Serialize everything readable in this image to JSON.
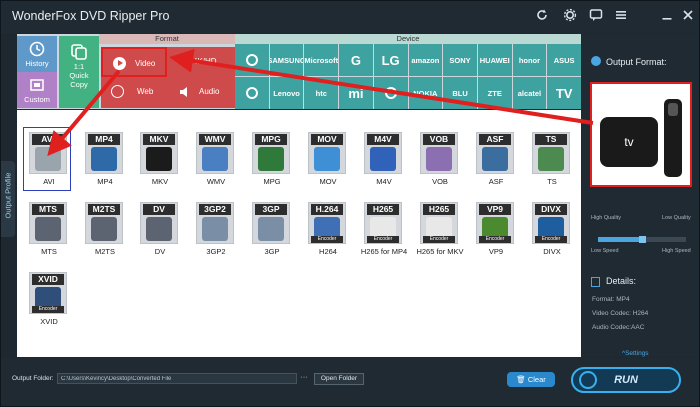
{
  "app": {
    "title": "WonderFox DVD Ripper Pro"
  },
  "ribbon": {
    "format_header": "Format",
    "device_header": "Device",
    "history": "History",
    "custom": "Custom",
    "quick_copy_line1": "1:1",
    "quick_copy_line2": "Quick",
    "quick_copy_line3": "Copy",
    "video": "Video",
    "fourk": "4K/HD",
    "web": "Web",
    "audio": "Audio",
    "brands_row1": [
      "",
      "SAMSUNG",
      "Microsoft",
      "G",
      "LG",
      "amazon",
      "SONY",
      "HUAWEI",
      "honor",
      "ASUS"
    ],
    "brands_row2": [
      "",
      "Lenovo",
      "htc",
      "mi",
      "",
      "NOKIA",
      "BLU",
      "ZTE",
      "alcatel",
      "TV"
    ]
  },
  "profile_tab": "Output Profile",
  "formats": [
    {
      "badge": "AVI",
      "name": "AVI",
      "color": "#9aa4ad"
    },
    {
      "badge": "MP4",
      "name": "MP4",
      "color": "#2e6aa8"
    },
    {
      "badge": "MKV",
      "name": "MKV",
      "color": "#1b1b1b"
    },
    {
      "badge": "WMV",
      "name": "WMV",
      "color": "#4a7fc1"
    },
    {
      "badge": "MPG",
      "name": "MPG",
      "color": "#2f7a3a"
    },
    {
      "badge": "MOV",
      "name": "MOV",
      "color": "#3f8fd6"
    },
    {
      "badge": "M4V",
      "name": "M4V",
      "color": "#2f62b8"
    },
    {
      "badge": "VOB",
      "name": "VOB",
      "color": "#8b6fb0"
    },
    {
      "badge": "ASF",
      "name": "ASF",
      "color": "#3b6e9e"
    },
    {
      "badge": "TS",
      "name": "TS",
      "color": "#4c8a4f"
    },
    {
      "badge": "MTS",
      "name": "MTS",
      "color": "#5b6470"
    },
    {
      "badge": "M2TS",
      "name": "M2TS",
      "color": "#5b6470"
    },
    {
      "badge": "DV",
      "name": "DV",
      "color": "#5b6470"
    },
    {
      "badge": "3GP2",
      "name": "3GP2",
      "color": "#7a8fa6"
    },
    {
      "badge": "3GP",
      "name": "3GP",
      "color": "#7a8fa6"
    },
    {
      "badge": "H.264",
      "name": "H264",
      "color": "#3f6fb5",
      "enc": "Encoder"
    },
    {
      "badge": "H265",
      "name": "H265 for MP4",
      "color": "#e8e8e8",
      "enc": "Encoder"
    },
    {
      "badge": "H265",
      "name": "H265 for MKV",
      "color": "#e8e8e8",
      "enc": "Encoder"
    },
    {
      "badge": "VP9",
      "name": "VP9",
      "color": "#4c8a2f",
      "enc": "Encoder"
    },
    {
      "badge": "DIVX",
      "name": "DIVX",
      "color": "#1f5e9e",
      "enc": "Encoder"
    },
    {
      "badge": "XVID",
      "name": "XVID",
      "color": "#2f4f7a",
      "enc": "Encoder"
    }
  ],
  "output": {
    "title": "Output Format:",
    "preview_text": "tv",
    "high_quality": "High Quality",
    "low_quality": "Low Quality",
    "low_speed": "Low Speed",
    "high_speed": "High Speed",
    "quality_level": 0.5
  },
  "details": {
    "title": "Details:",
    "format": "Format: MP4",
    "video_codec": "Video Codec: H264",
    "audio_codec": "Audio Codec:AAC",
    "settings": "Settings"
  },
  "bottom": {
    "folder_label": "Output Folder:",
    "folder_path": "C:\\Users\\Kevincy\\Desktop\\Converted File",
    "browse": "···",
    "open_folder": "Open Folder",
    "clear": "Clear",
    "run": "RUN"
  },
  "colors": {
    "accent": "#4aa6e0",
    "highlight_red": "#e01f1f",
    "format_red": "#cf4a4a",
    "device_teal": "#3ea3a0"
  }
}
